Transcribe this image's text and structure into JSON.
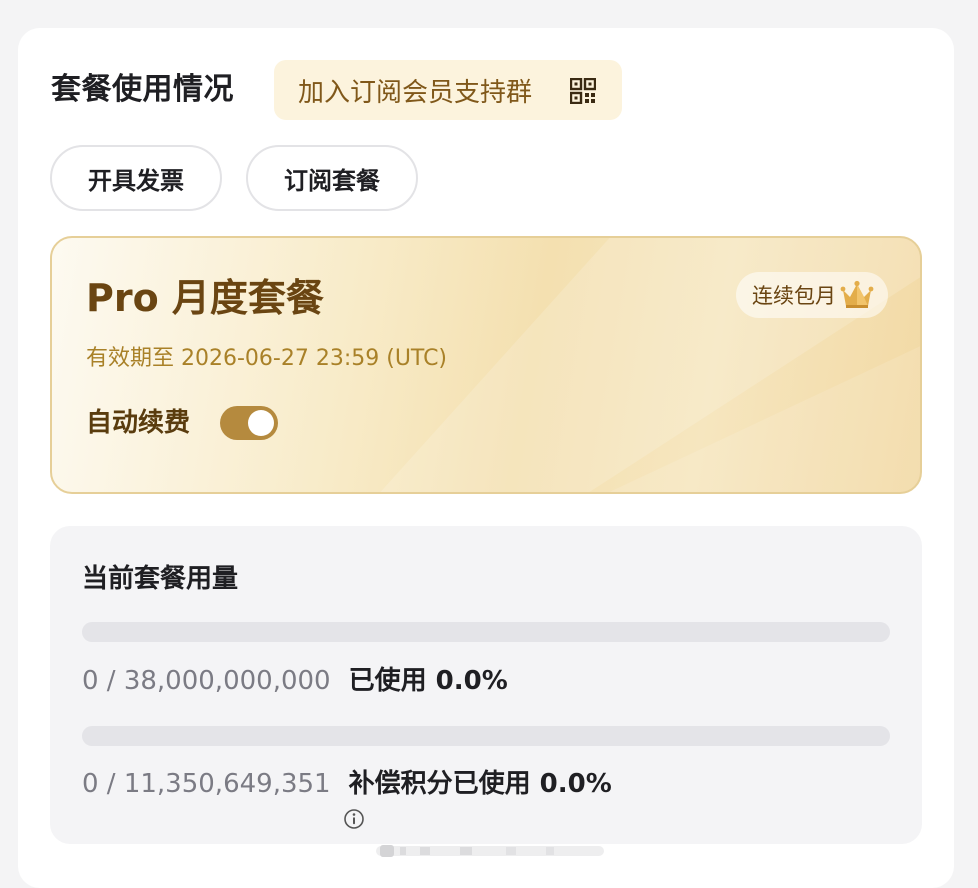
{
  "header": {
    "title": "套餐使用情况",
    "join_group_label": "加入订阅会员支持群"
  },
  "actions": {
    "invoice_label": "开具发票",
    "subscribe_label": "订阅套餐"
  },
  "plan": {
    "name": "Pro 月度套餐",
    "badge_label": "连续包月",
    "valid_until": "有效期至 2026-06-27 23:59 (UTC)",
    "auto_renew_label": "自动续费",
    "auto_renew_on": true
  },
  "usage": {
    "title": "当前套餐用量",
    "quota": {
      "count_text": "0 / 38,000,000,000",
      "used_text": "已使用 0.0%",
      "progress_percent": 0.0
    },
    "compensation": {
      "count_text": "0 / 11,350,649,351",
      "used_text": "补偿积分已使用 0.0%",
      "progress_percent": 0.0
    }
  },
  "colors": {
    "accent_gold": "#b58a3e",
    "plan_text": "#6a4512",
    "join_bg": "#fcf3dd"
  }
}
